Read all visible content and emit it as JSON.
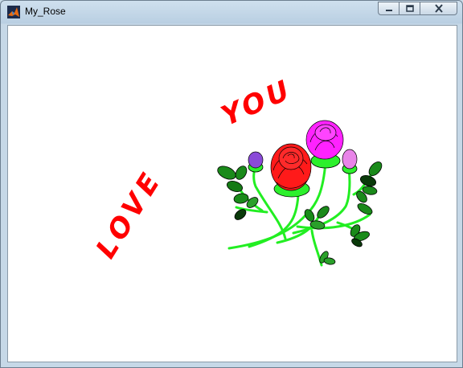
{
  "window": {
    "title": "My_Rose",
    "icon": "matlab-icon",
    "controls": {
      "minimize": "minimize-icon",
      "maximize": "maximize-icon",
      "close": "close-icon"
    }
  },
  "figure": {
    "text_love": "LOVE",
    "text_you": "YOU",
    "colors": {
      "text": "#ff0000",
      "stem": "#22ee22",
      "leaf_dark": "#1a8a1a",
      "rose_red": "#ff1a1a",
      "rose_magenta": "#ff22ff",
      "bud_purple": "#8a4ad8",
      "bud_pink": "#e884e8",
      "sepal": "#2cf02c"
    }
  }
}
